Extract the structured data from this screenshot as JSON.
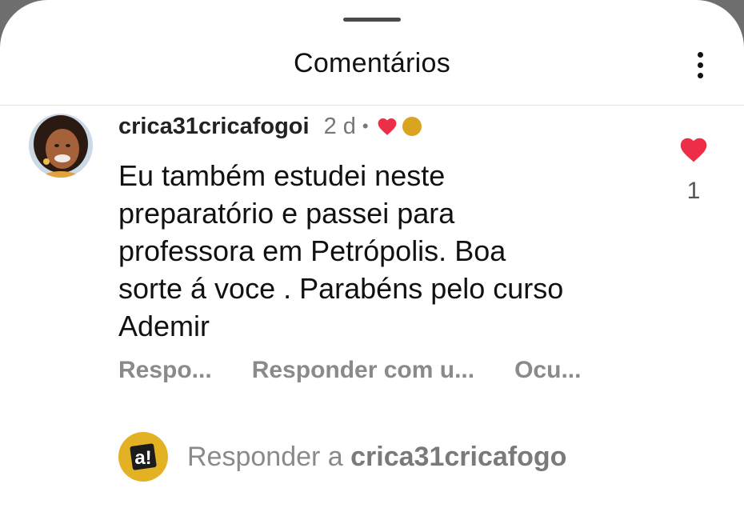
{
  "header": {
    "title": "Comentários",
    "more_icon": "more-vertical-icon"
  },
  "comment": {
    "username": "crica31cricafogoi",
    "time": "2 d",
    "separator": "•",
    "author_badges": [
      "heart-icon",
      "yellow-circle-icon"
    ],
    "text": "Eu também estudei neste\npreparatório e passei para\nprofessora em Petrópolis.  Boa\nsorte á voce . Parabéns pelo curso\nAdemir",
    "like_icon": "heart-icon",
    "like_count": "1",
    "actions": {
      "reply": "Respo...",
      "reply_with": "Responder com u...",
      "hide": "Ocu..."
    }
  },
  "reply_bar": {
    "prefix": "Responder a",
    "username": "crica31cricafogo"
  },
  "colors": {
    "like": "#ed2e48",
    "badge_circle": "#d9a521",
    "reply_avatar": "#e3b224",
    "secondary_text": "#8a8a8a"
  }
}
